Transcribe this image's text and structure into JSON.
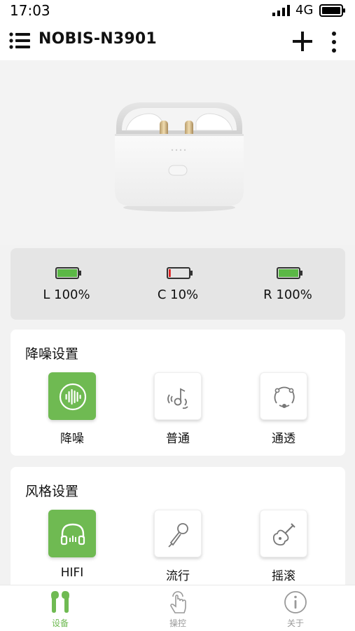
{
  "status_bar": {
    "time": "17:03",
    "network": "4G"
  },
  "header": {
    "title": "NOBIS-N3901"
  },
  "battery": [
    {
      "label": "L 100%",
      "level": 1.0,
      "color": "#5bb846"
    },
    {
      "label": "C 10%",
      "level": 0.1,
      "color": "#e02020"
    },
    {
      "label": "R 100%",
      "level": 1.0,
      "color": "#5bb846"
    }
  ],
  "noise_card": {
    "title": "降噪设置",
    "options": [
      {
        "label": "降噪",
        "icon": "sound-wave-icon",
        "active": true
      },
      {
        "label": "普通",
        "icon": "ear-music-icon",
        "active": false
      },
      {
        "label": "通透",
        "icon": "transparency-icon",
        "active": false
      }
    ]
  },
  "style_card": {
    "title": "风格设置",
    "options": [
      {
        "label": "HIFI",
        "icon": "headphones-icon",
        "active": true
      },
      {
        "label": "流行",
        "icon": "microphone-icon",
        "active": false
      },
      {
        "label": "摇滚",
        "icon": "guitar-icon",
        "active": false
      }
    ]
  },
  "nav": [
    {
      "label": "设备",
      "icon": "earbuds-icon",
      "active": true
    },
    {
      "label": "操控",
      "icon": "hand-tap-icon",
      "active": false
    },
    {
      "label": "关于",
      "icon": "info-icon",
      "active": false
    }
  ],
  "colors": {
    "accent": "#6fba52",
    "battery_full": "#5bb846",
    "battery_low": "#e02020"
  }
}
